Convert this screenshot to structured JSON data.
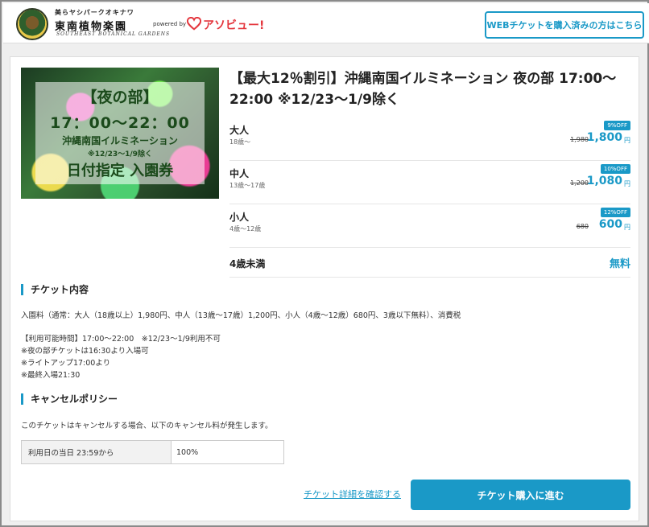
{
  "header": {
    "logo": {
      "top_text": "美らヤシパークオキナワ",
      "main_text": "東南植物楽園",
      "sub_text": "SOUTHEAST BOTANICAL GARDENS"
    },
    "powered_by": "powered by",
    "brand": "アソビュー!",
    "web_ticket_button": "WEBチケットを購入済みの方はこちら"
  },
  "hero": {
    "line1": "【夜の部】",
    "line2": "17：00〜22：00",
    "line3": "沖縄南国イルミネーション",
    "line4": "※12/23〜1/9除く",
    "line5": "日付指定 入園券"
  },
  "product": {
    "title": "【最大12％割引】沖縄南国イルミネーション 夜の部 17:00〜22:00 ※12/23〜1/9除く",
    "prices": [
      {
        "label": "大人",
        "age": "18歳〜",
        "badge": "9%OFF",
        "original": "1,980",
        "price": "1,800",
        "unit": "円"
      },
      {
        "label": "中人",
        "age": "13歳〜17歳",
        "badge": "10%OFF",
        "original": "1,200",
        "price": "1,080",
        "unit": "円"
      },
      {
        "label": "小人",
        "age": "4歳〜12歳",
        "badge": "12%OFF",
        "original": "680",
        "price": "600",
        "unit": "円"
      }
    ],
    "infant": {
      "label": "4歳未満",
      "price": "無料"
    }
  },
  "ticket_contents": {
    "heading": "チケット内容",
    "admission": "入園料（通常：大人（18歳以上）1,980円、中人（13歳〜17歳）1,200円、小人（4歳〜12歳）680円、3歳以下無料）、消費税",
    "usage_lines": [
      "【利用可能時間】17:00〜22:00　※12/23〜1/9利用不可",
      "※夜の部チケットは16:30より入場可",
      "※ライトアップ17:00より",
      "※最終入場21:30"
    ]
  },
  "cancel_policy": {
    "heading": "キャンセルポリシー",
    "description": "このチケットはキャンセルする場合、以下のキャンセル料が発生します。",
    "rows": [
      {
        "when": "利用日の当日 23:59から",
        "fee": "100%"
      }
    ]
  },
  "actions": {
    "detail_link": "チケット詳細を確認する",
    "buy_button": "チケット購入に進む"
  },
  "colors": {
    "accent": "#1a99c7",
    "brand_red": "#e4363d"
  }
}
